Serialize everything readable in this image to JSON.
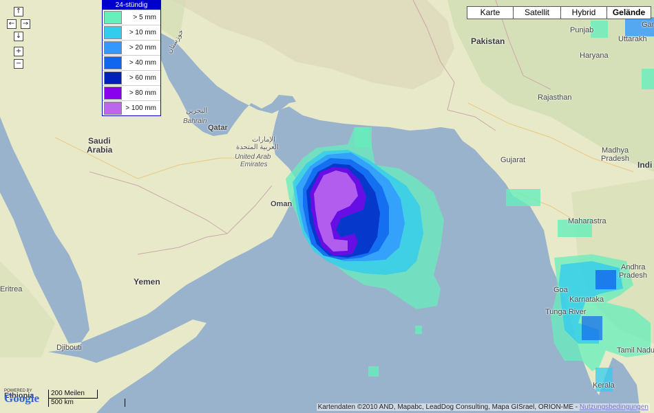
{
  "nav": {
    "up": "↑",
    "left": "←",
    "right": "→",
    "down": "↓",
    "zoom_in": "+",
    "zoom_out": "−"
  },
  "legend": {
    "title": "24-stündig",
    "items": [
      {
        "label": "> 5 mm",
        "color": "#66eebb"
      },
      {
        "label": "> 10 mm",
        "color": "#33ccee"
      },
      {
        "label": "> 20 mm",
        "color": "#3399ff"
      },
      {
        "label": "> 40 mm",
        "color": "#1166ee"
      },
      {
        "label": "> 60 mm",
        "color": "#0022bb"
      },
      {
        "label": "> 80 mm",
        "color": "#8800ee"
      },
      {
        "label": "> 100 mm",
        "color": "#bb66ee"
      }
    ]
  },
  "map_types": {
    "karte": "Karte",
    "satellit": "Satellit",
    "hybrid": "Hybrid",
    "gelaende": "Gelände",
    "active": "Gelände"
  },
  "labels": {
    "pakistan": "Pakistan",
    "punjab": "Punjab",
    "uttarakhand": "Uttarakh",
    "garh": "Gar",
    "haryana": "Haryana",
    "rajasthan": "Rajasthan",
    "madhya": "Madhya",
    "pradesh": "Pradesh",
    "india": "Indi",
    "gujarat": "Gujarat",
    "maharastra": "Maharastra",
    "andhra": "Andhra",
    "andhra_pradesh": "Pradesh",
    "goa": "Goa",
    "karnataka": "Karnataka",
    "tunga": "Tunga River",
    "tamil": "Tamil Nadu",
    "kerala": "Kerala",
    "saudi": "Saudi",
    "arabia": "Arabia",
    "bahrain_ar": "البحرين",
    "bahrain": "Bahrain",
    "qatar": "Qatar",
    "uae_ar1": "الإمارات",
    "uae_ar2": "العربية المتحدة",
    "uae1": "United Arab",
    "uae2": "Emirates",
    "oman": "Oman",
    "yemen": "Yemen",
    "eritrea": "Eritrea",
    "djibouti": "Djibouti",
    "ethiopia": "Ethiopia",
    "khouzestan": "خوزستان"
  },
  "scale": {
    "miles": "200 Meilen",
    "km": "500 km"
  },
  "logo": {
    "text": "Google",
    "powered": "POWERED BY"
  },
  "copyright": {
    "text": "Kartendaten ©2010 AND, Mapabc, LeadDog Consulting, Mapa GISrael, ORION-ME -",
    "terms": "Nutzungsbedingungen"
  },
  "colors": {
    "sea": "#99b3cc",
    "land": "#e6e8c8",
    "land_green": "#cddcb0",
    "rain_5": "#66eebb",
    "rain_10": "#33ccee",
    "rain_20": "#3399ff",
    "rain_40": "#1166ee",
    "rain_60": "#0022bb",
    "rain_80": "#8800ee",
    "rain_100": "#bb66ee"
  }
}
